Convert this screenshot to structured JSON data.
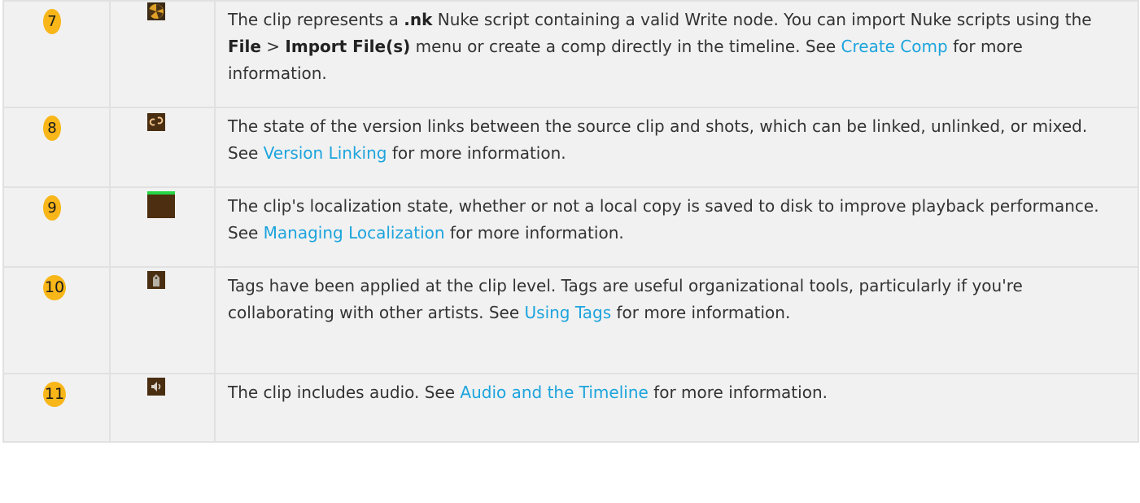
{
  "rows": [
    {
      "number": "7",
      "icon": "nuke-script-icon",
      "text_before": "The clip represents a ",
      "bold1": ".nk",
      "text_mid1": " Nuke script containing a valid Write node. You can import Nuke scripts using the ",
      "bold2": "File",
      "text_mid2": " > ",
      "bold3": "Import File(s)",
      "text_mid3": " menu or create a comp directly in the timeline. See ",
      "link": "Create Comp",
      "text_after": " for more information."
    },
    {
      "number": "8",
      "icon": "version-link-icon",
      "text_before": "The state of the version links between the source clip and shots, which can be linked, unlinked, or mixed. See ",
      "link": "Version Linking",
      "text_after": " for more information."
    },
    {
      "number": "9",
      "icon": "localization-state-icon",
      "text_before": "The clip's localization state, whether or not a local copy is saved to disk to improve playback performance. See ",
      "link": "Managing Localization",
      "text_after": " for more information."
    },
    {
      "number": "10",
      "icon": "tag-icon",
      "text_before": "Tags have been applied at the clip level. Tags are useful organizational tools, particularly if you're collaborating with other artists. See ",
      "link": "Using Tags",
      "text_after": " for more information."
    },
    {
      "number": "11",
      "icon": "audio-icon",
      "text_before": "The clip includes audio. See ",
      "link": "Audio and the Timeline",
      "text_after": " for more information."
    }
  ],
  "colors": {
    "badge": "#f8b619",
    "link": "#1ca4dd",
    "row_bg": "#f1f1f1",
    "border": "#e1e1e1"
  }
}
